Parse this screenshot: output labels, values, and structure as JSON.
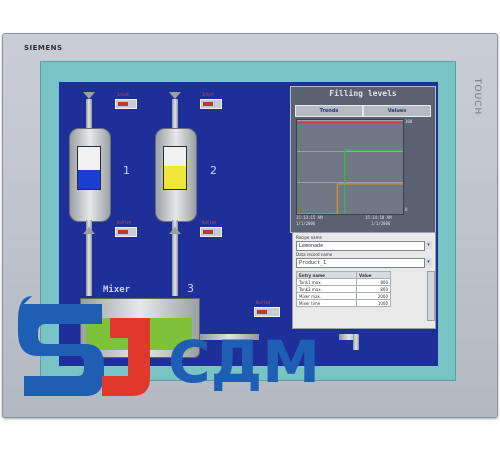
{
  "device": {
    "brand": "SIEMENS",
    "model_text": "TOUCH"
  },
  "process": {
    "tank1": {
      "number": "1",
      "fill_pct": 45,
      "fill_color": "#1b3ed0",
      "label_top": "Inlet",
      "label_bottom": "Outlet"
    },
    "tank2": {
      "number": "2",
      "fill_pct": 55,
      "fill_color": "#f0e63a",
      "label_top": "Inlet",
      "label_bottom": "Outlet"
    },
    "mixer": {
      "label": "Mixer",
      "number": "3",
      "fill_pct": 60,
      "fill_color": "#7ec13a",
      "outlet_label": "Outlet"
    }
  },
  "filling_levels": {
    "title": "Filling levels",
    "tabs": [
      "Trends",
      "Values"
    ],
    "y_ticks_right": [
      "100",
      "",
      "",
      "0"
    ],
    "x_ticks": [
      "15:13:15 AM",
      "15:14:10 AM"
    ],
    "x_dates": [
      "1/1/2006",
      "1/1/2006"
    ]
  },
  "chart_data": {
    "type": "line",
    "title": "Filling levels",
    "xlabel": "",
    "ylabel": "",
    "series": [
      {
        "name": "",
        "color": "#3ab64a",
        "points": [
          [
            0,
            0
          ],
          [
            0.45,
            0
          ],
          [
            0.45,
            0.68
          ],
          [
            1,
            0.68
          ]
        ]
      },
      {
        "name": "",
        "color": "#e0901e",
        "points": [
          [
            0,
            0
          ],
          [
            0.38,
            0
          ],
          [
            0.38,
            0.32
          ],
          [
            1,
            0.32
          ]
        ]
      },
      {
        "name": "",
        "color": "#d63a3a",
        "points": [
          [
            0,
            0.97
          ],
          [
            1,
            0.97
          ]
        ]
      }
    ],
    "xlim": [
      0,
      1
    ],
    "ylim": [
      0,
      1
    ],
    "grid": true
  },
  "recipe": {
    "recipe_name_label": "Recipe name",
    "recipe_name_value": "Lemonade",
    "data_record_label": "Data record name",
    "data_record_value": "Product_1",
    "table_headers": [
      "Entry name",
      "Value"
    ],
    "rows": [
      [
        "Tank1 max.",
        "800"
      ],
      [
        "Tank2 max.",
        "800"
      ],
      [
        "Mixer max.",
        "2000"
      ],
      [
        "Mixer time",
        "1000"
      ]
    ]
  },
  "watermark": {
    "text": "СДМ",
    "colors": {
      "red": "#e0392c",
      "blue": "#1f5fb3"
    }
  }
}
